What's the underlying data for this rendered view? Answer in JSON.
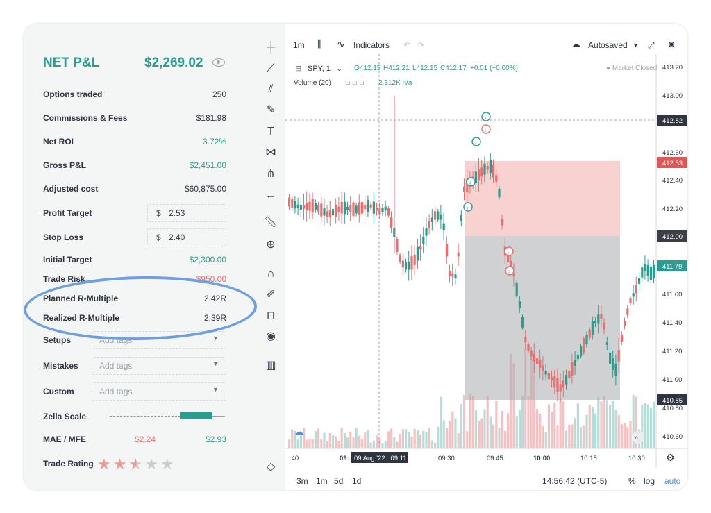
{
  "summary": {
    "title": "NET P&L",
    "net_value": "$2,269.02",
    "rows": [
      {
        "label": "Options traded",
        "value": "250"
      },
      {
        "label": "Commissions & Fees",
        "value": "$181.98"
      },
      {
        "label": "Net ROI",
        "value": "3.72%"
      },
      {
        "label": "Gross P&L",
        "value": "$2,451.00"
      },
      {
        "label": "Adjusted cost",
        "value": "$60,875.00"
      }
    ],
    "profit_target": {
      "label": "Profit Target",
      "currency": "$",
      "value": "2.53"
    },
    "stop_loss": {
      "label": "Stop Loss",
      "currency": "$",
      "value": "2.40"
    },
    "initial_target": {
      "label": "Initial Target",
      "value": "$2,300.00"
    },
    "trade_risk": {
      "label": "Trade Risk",
      "value": "$950.00"
    },
    "planned_r": {
      "label": "Planned R-Multiple",
      "value": "2.42R"
    },
    "realized_r": {
      "label": "Realized R-Multiple",
      "value": "2.39R"
    },
    "setups": {
      "label": "Setups",
      "placeholder": "Add tags"
    },
    "mistakes": {
      "label": "Mistakes",
      "placeholder": "Add tags"
    },
    "custom": {
      "label": "Custom",
      "placeholder": "Add tags"
    },
    "zella": {
      "label": "Zella Scale",
      "level": 0.72
    },
    "mae_mfe": {
      "label": "MAE / MFE",
      "mae": "$2.24",
      "mfe": "$2.93"
    },
    "rating": {
      "label": "Trade Rating",
      "stars": 2.5,
      "max": 5
    }
  },
  "colors": {
    "green": "#2a9d8f",
    "red": "#e76f6f",
    "highlight": "#6f9fe3"
  },
  "toolbar_icons": [
    "crosshair-icon",
    "trendline-icon",
    "fib-icon",
    "brush-icon",
    "text-icon",
    "pattern-icon",
    "forecast-icon",
    "back-arrow-icon",
    "ruler-icon",
    "zoom-in-icon",
    "magnet-icon",
    "lock-draw-icon",
    "lock-icon",
    "eye-icon",
    "trash-icon",
    "layers-icon"
  ],
  "chart": {
    "interval": "1m",
    "indicators_label": "Indicators",
    "autosave_label": "Autosaved",
    "symbol": "SPY, 1",
    "ohlc": {
      "o": "O412.15",
      "h": "H412.21",
      "l": "L412.15",
      "c": "C412.17",
      "chg": "+0.01 (+0.00%)"
    },
    "market_status": "Market Closed",
    "volume_label": "Volume (20)",
    "volume_value": "2.312K n/a",
    "price_ticks": [
      "413.20",
      "413.00",
      "412.60",
      "412.40",
      "412.20",
      "411.60",
      "411.40",
      "411.20",
      "411.00",
      "410.80",
      "410.60"
    ],
    "price_markers": {
      "crosshair": "412.82",
      "red": "412.53",
      "dark": "412.00",
      "green": "411.79",
      "low": "410.85"
    },
    "time_ticks": [
      ":40",
      "09:",
      "09:30",
      "09:45",
      "10:00",
      "10:15",
      "10:30"
    ],
    "crosshair_time": "09 Aug '22   09:11",
    "ranges": [
      "3m",
      "1m",
      "5d",
      "1d"
    ],
    "clock": "14:56:42 (UTC-5)",
    "scale_opts": [
      "%",
      "log",
      "auto"
    ]
  }
}
